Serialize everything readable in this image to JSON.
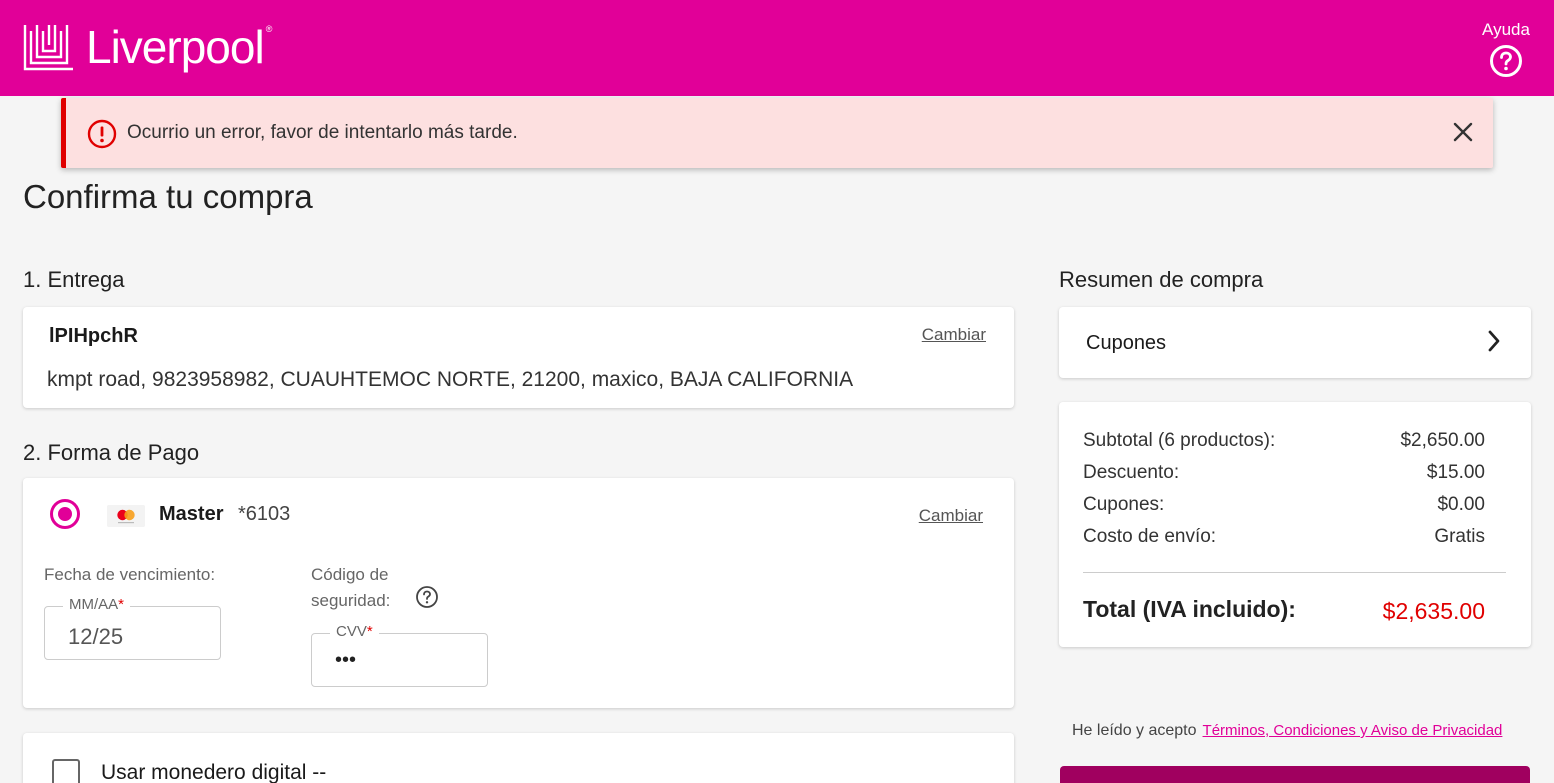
{
  "header": {
    "brand": "Liverpool",
    "registered": "®",
    "help_label": "Ayuda",
    "background_color": "#e10098"
  },
  "alert": {
    "message": "Ocurrio un error, favor de intentarlo más tarde.",
    "icon": "error-icon",
    "color": "#e00000"
  },
  "page": {
    "title": "Confirma tu compra"
  },
  "delivery": {
    "section_title": "1. Entrega",
    "name": "lPIHpchR",
    "address": "kmpt road, 9823958982, CUAUHTEMOC NORTE, 21200, maxico, BAJA CALIFORNIA",
    "change_label": "Cambiar"
  },
  "payment": {
    "section_title": "2. Forma de Pago",
    "card_brand": "Master",
    "card_number": "*6103",
    "change_label": "Cambiar",
    "expiry_label": "Fecha de vencimiento:",
    "expiry_placeholder": "MM/AA",
    "expiry_value": "12/25",
    "cvv_label_line1": "Código de",
    "cvv_label_line2": "seguridad:",
    "cvv_placeholder": "CVV",
    "cvv_value": "•••",
    "required_mark": "*"
  },
  "wallet": {
    "label": "Usar monedero digital --"
  },
  "summary": {
    "section_title": "Resumen de compra",
    "coupons_label": "Cupones",
    "rows": [
      {
        "label": "Subtotal (6 productos):",
        "value": "$2,650.00"
      },
      {
        "label": "Descuento:",
        "value": "$15.00"
      },
      {
        "label": "Cupones:",
        "value": "$0.00"
      },
      {
        "label": "Costo de envío:",
        "value": "Gratis"
      }
    ],
    "total_label": "Total (IVA incluido):",
    "total_value": "$2,635.00"
  },
  "terms": {
    "prefix": "He leído y acepto",
    "link": "Términos, Condiciones y Aviso de Privacidad"
  }
}
